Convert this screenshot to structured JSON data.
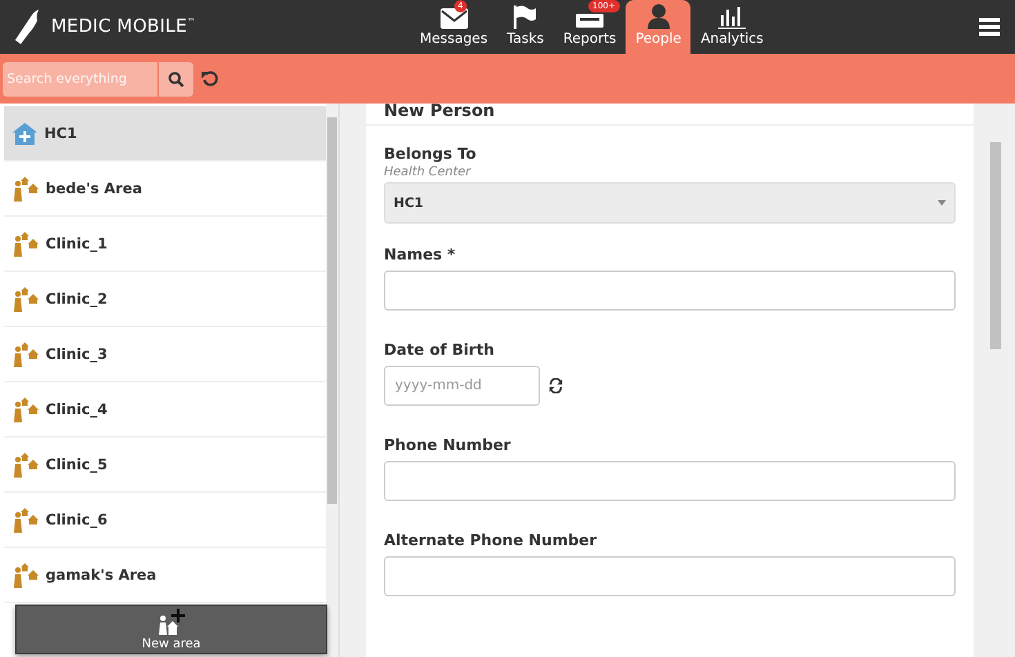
{
  "brand": {
    "name": "MEDIC MOBILE",
    "mark": "™"
  },
  "tabs": [
    {
      "label": "Messages",
      "kind": "messages",
      "badge": "4",
      "selected": false
    },
    {
      "label": "Tasks",
      "kind": "tasks",
      "selected": false
    },
    {
      "label": "Reports",
      "kind": "reports",
      "badge": "100+",
      "selected": false
    },
    {
      "label": "People",
      "kind": "people",
      "selected": true
    },
    {
      "label": "Analytics",
      "kind": "analytics",
      "selected": false
    }
  ],
  "search": {
    "placeholder": "Search everything"
  },
  "places": [
    {
      "name": "HC1",
      "kind": "health_center",
      "selected": true
    },
    {
      "name": "bede's Area",
      "kind": "area",
      "selected": false
    },
    {
      "name": "Clinic_1",
      "kind": "area",
      "selected": false
    },
    {
      "name": "Clinic_2",
      "kind": "area",
      "selected": false
    },
    {
      "name": "Clinic_3",
      "kind": "area",
      "selected": false
    },
    {
      "name": "Clinic_4",
      "kind": "area",
      "selected": false
    },
    {
      "name": "Clinic_5",
      "kind": "area",
      "selected": false
    },
    {
      "name": "Clinic_6",
      "kind": "area",
      "selected": false
    },
    {
      "name": "gamak's Area",
      "kind": "area",
      "selected": false
    }
  ],
  "new_area_button": {
    "label": "New area"
  },
  "form": {
    "title": "New Person",
    "fields": [
      {
        "kind": "select",
        "label": "Belongs To",
        "hint": "Health Center",
        "value": "HC1"
      },
      {
        "kind": "text",
        "label": "Names *"
      },
      {
        "kind": "date",
        "label": "Date of Birth",
        "placeholder": "yyyy-mm-dd"
      },
      {
        "kind": "text",
        "label": "Phone Number"
      },
      {
        "kind": "text",
        "label": "Alternate Phone Number"
      }
    ]
  }
}
